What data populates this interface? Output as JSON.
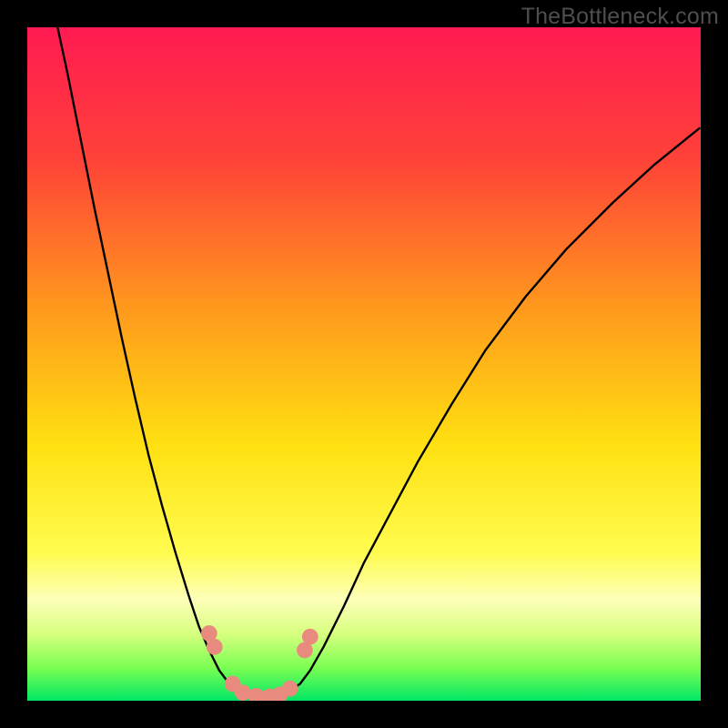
{
  "watermark": "TheBottleneck.com",
  "chart_data": {
    "type": "line",
    "title": "",
    "xlabel": "",
    "ylabel": "",
    "xlim": [
      0,
      100
    ],
    "ylim": [
      0,
      100
    ],
    "grid": false,
    "legend": "none",
    "gradient_stops": [
      {
        "offset": 0,
        "color": "#ff1a52"
      },
      {
        "offset": 20,
        "color": "#ff4338"
      },
      {
        "offset": 42,
        "color": "#ff9a1c"
      },
      {
        "offset": 62,
        "color": "#ffe011"
      },
      {
        "offset": 78,
        "color": "#fffc4f"
      },
      {
        "offset": 85,
        "color": "#fdffb9"
      },
      {
        "offset": 90,
        "color": "#d8ff80"
      },
      {
        "offset": 95,
        "color": "#7dff52"
      },
      {
        "offset": 100,
        "color": "#00e765"
      }
    ],
    "series": [
      {
        "name": "left-curve",
        "x": [
          4.5,
          6,
          8,
          10,
          12,
          14,
          16,
          18,
          20,
          22,
          24,
          25.5,
          27,
          28.5,
          30,
          31
        ],
        "y": [
          100,
          93,
          83,
          73,
          63.5,
          54,
          45,
          36.5,
          29,
          22,
          15.5,
          11,
          7.5,
          4.5,
          2.5,
          1.5
        ]
      },
      {
        "name": "right-curve",
        "x": [
          39,
          40.5,
          42,
          44,
          47,
          50,
          54,
          58,
          63,
          68,
          74,
          80,
          87,
          93,
          99.8
        ],
        "y": [
          1.5,
          2.5,
          4.5,
          8,
          14,
          20.5,
          28,
          35.5,
          44,
          52,
          60,
          67,
          74,
          79.5,
          85
        ]
      },
      {
        "name": "valley-floor",
        "x": [
          31,
          32.5,
          34.5,
          36.5,
          38,
          39
        ],
        "y": [
          1.5,
          0.7,
          0.4,
          0.4,
          0.7,
          1.5
        ]
      }
    ],
    "markers": {
      "name": "pink-dots",
      "color": "#e88b7e",
      "radius_pct": 1.2,
      "points": [
        {
          "x": 27.0,
          "y": 10.0
        },
        {
          "x": 27.8,
          "y": 8.0
        },
        {
          "x": 30.5,
          "y": 2.5
        },
        {
          "x": 32.0,
          "y": 1.2
        },
        {
          "x": 34.0,
          "y": 0.7
        },
        {
          "x": 36.0,
          "y": 0.6
        },
        {
          "x": 37.5,
          "y": 0.9
        },
        {
          "x": 39.0,
          "y": 1.8
        },
        {
          "x": 41.2,
          "y": 7.5
        },
        {
          "x": 42.0,
          "y": 9.5
        }
      ]
    }
  }
}
